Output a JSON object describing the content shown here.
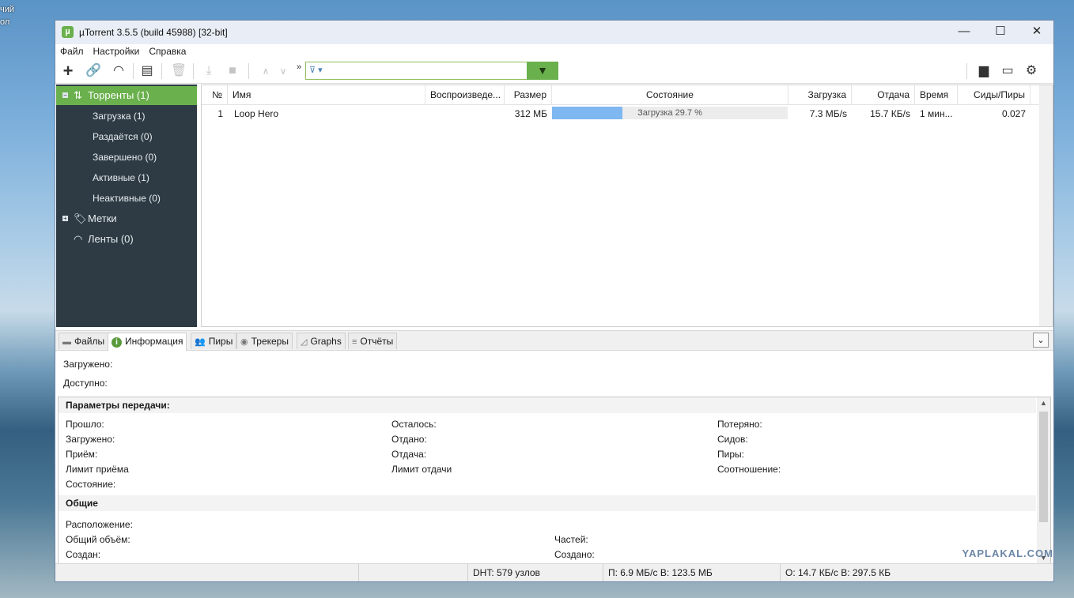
{
  "desktop": {
    "text1": "чий",
    "text2": "ол"
  },
  "window": {
    "title": "µTorrent 3.5.5  (build 45988) [32-bit]",
    "app_icon_letter": "µ",
    "controls": {
      "minimize": "—",
      "maximize": "☐",
      "close": "✕"
    }
  },
  "menu": [
    "Файл",
    "Настройки",
    "Справка"
  ],
  "search": {
    "value": "",
    "placeholder": ""
  },
  "sidebar": {
    "torrents": "Торренты (1)",
    "sub": [
      "Загрузка (1)",
      "Раздаётся (0)",
      "Завершено (0)",
      "Активные (1)",
      "Неактивные (0)"
    ],
    "labels": "Метки",
    "feeds": "Ленты (0)"
  },
  "table": {
    "headers": [
      "№",
      "Имя",
      "Воспроизведе...",
      "Размер",
      "Состояние",
      "Загрузка",
      "Отдача",
      "Время",
      "Сиды/Пиры"
    ],
    "rows": [
      {
        "num": "1",
        "name": "Loop Hero",
        "play": "",
        "size": "312 МБ",
        "status": "Загрузка 29.7 %",
        "progress": 0.297,
        "down": "7.3 МБ/s",
        "up": "15.7 КБ/s",
        "eta": "1 мин...",
        "ratio": "0.027"
      }
    ]
  },
  "tabs": [
    "Файлы",
    "Информация",
    "Пиры",
    "Трекеры",
    "Graphs",
    "Отчёты"
  ],
  "info": {
    "downloaded": "Загружено:",
    "available": "Доступно:"
  },
  "transfer": {
    "title": "Параметры передачи:",
    "col1": [
      "Прошло:",
      "Загружено:",
      "Приём:",
      "Лимит приёма",
      "Состояние:"
    ],
    "col2": [
      "Осталось:",
      "Отдано:",
      "Отдача:",
      "Лимит отдачи"
    ],
    "col3": [
      "Потеряно:",
      "Сидов:",
      "Пиры:",
      "Соотношение:"
    ]
  },
  "general": {
    "title": "Общие",
    "col1": [
      "Расположение:",
      "Общий объём:",
      "Создан:"
    ],
    "col2": [
      "Частей:",
      "Создано:"
    ]
  },
  "status": {
    "dht": "DHT: 579 узлов",
    "down": "П: 6.9 МБ/с В: 123.5 МБ",
    "up": "О: 14.7 КБ/с В: 297.5 КБ"
  },
  "watermark": "YAPLAKAL.COM"
}
